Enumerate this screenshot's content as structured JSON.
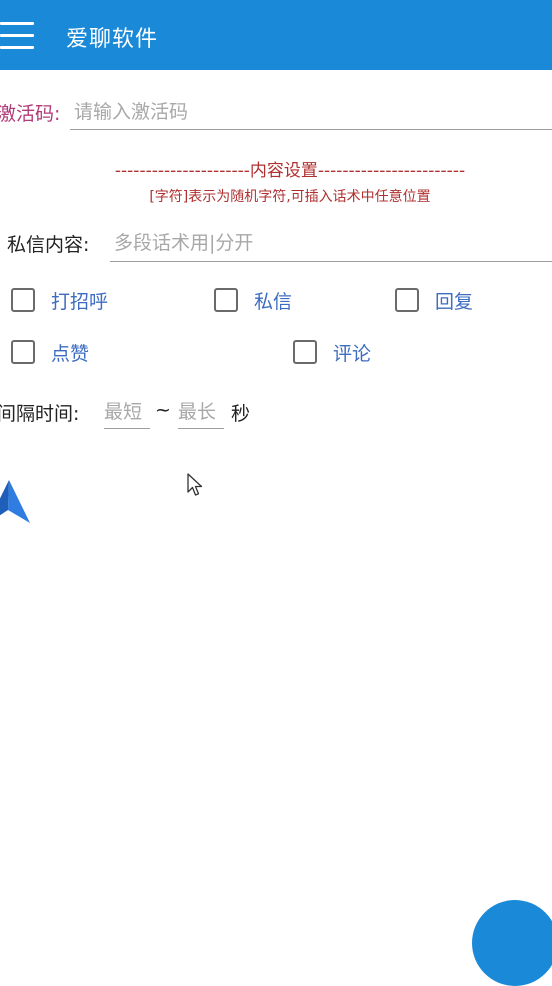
{
  "app": {
    "title": "爱聊软件",
    "menu_icon": "hamburger-menu-icon",
    "accent_color": "#1a8ad8"
  },
  "activation": {
    "label": "激活码:",
    "placeholder": "请输入激活码",
    "value": ""
  },
  "content_settings": {
    "title": "----------------------内容设置------------------------",
    "note": "[字符]表示为随机字符,可插入话术中任意位置",
    "message_label": "私信内容:",
    "message_placeholder": "多段话术用|分开",
    "message_value": ""
  },
  "options": [
    {
      "label": "打招呼",
      "checked": false
    },
    {
      "label": "私信",
      "checked": false
    },
    {
      "label": "回复",
      "checked": false
    },
    {
      "label": "点赞",
      "checked": false
    },
    {
      "label": "评论",
      "checked": false
    }
  ],
  "interval": {
    "label": "间隔时间:",
    "min_placeholder": "最短",
    "separator": "~",
    "max_placeholder": "最长",
    "unit": "秒"
  },
  "icons": {
    "nav_arrow": "navigation-arrow-icon",
    "cursor": "mouse-pointer-icon",
    "fab": "floating-action-button"
  }
}
